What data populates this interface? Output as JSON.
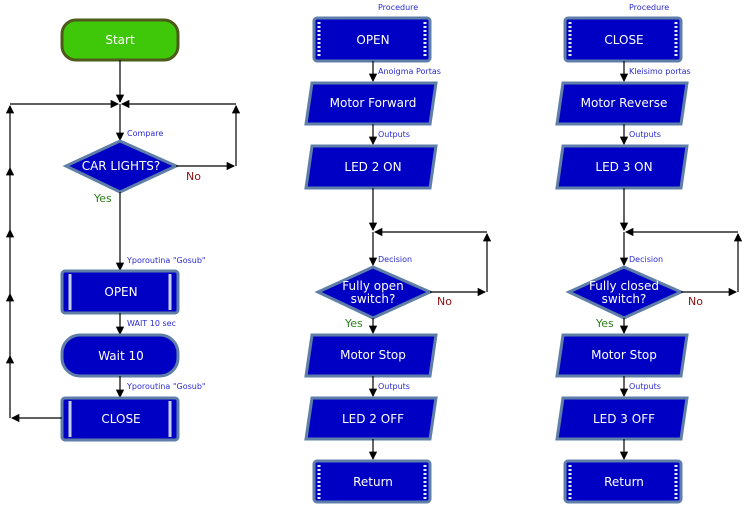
{
  "colors": {
    "shape_fill": "#0000c4",
    "start_fill": "#3fc80a",
    "label": "#2a2ad0",
    "yes": "#2e7d1a",
    "no": "#8a1010"
  },
  "main": {
    "start": "Start",
    "compare_label": "Compare",
    "decision": "CAR LIGHTS?",
    "yes": "Yes",
    "no": "No",
    "gosub1_label": "Yporoutina \"Gosub\"",
    "open_call": "OPEN",
    "wait_label": "WAIT 10 sec",
    "wait": "Wait 10",
    "gosub2_label": "Yporoutina \"Gosub\"",
    "close_call": "CLOSE"
  },
  "open_proc": {
    "procedure_label": "Procedure",
    "title": "OPEN",
    "output1_label": "Anoigma Portas",
    "output1": "Motor Forward",
    "output2_label": "Outputs",
    "output2": "LED 2 ON",
    "decision_label": "Decision",
    "decision_line1": "Fully open",
    "decision_line2": "switch?",
    "no": "No",
    "yes": "Yes",
    "output3": "Motor Stop",
    "output4_label": "Outputs",
    "output4": "LED 2 OFF",
    "return": "Return"
  },
  "close_proc": {
    "procedure_label": "Procedure",
    "title": "CLOSE",
    "output1_label": "Kleisimo portas",
    "output1": "Motor Reverse",
    "output2_label": "Outputs",
    "output2": "LED 3 ON",
    "decision_label": "Decision",
    "decision_line1": "Fully closed",
    "decision_line2": "switch?",
    "no": "No",
    "yes": "Yes",
    "output3": "Motor Stop",
    "output4_label": "Outputs",
    "output4": "LED 3 OFF",
    "return": "Return"
  }
}
